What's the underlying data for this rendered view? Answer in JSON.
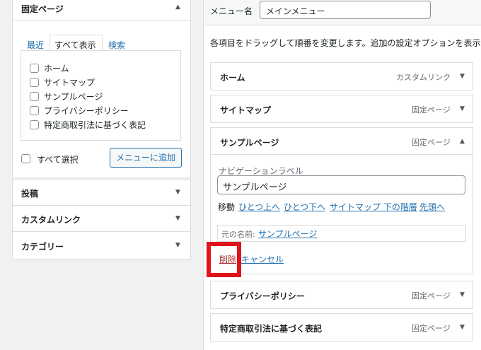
{
  "left": {
    "fixed_pages": {
      "title": "固定ページ",
      "tabs": [
        "最近",
        "すべて表示",
        "検索"
      ],
      "pages": [
        "ホーム",
        "サイトマップ",
        "サンプルページ",
        "プライバシーポリシー",
        "特定商取引法に基づく表記"
      ],
      "select_all": "すべて選択",
      "add_button": "メニューに追加"
    },
    "sections": [
      "投稿",
      "カスタムリンク",
      "カテゴリー"
    ]
  },
  "right": {
    "menu_name_label": "メニュー名",
    "menu_name_value": "メインメニュー",
    "instructions": "各項目をドラッグして順番を変更します。追加の設定オプションを表示す",
    "items": [
      {
        "title": "ホーム",
        "type": "カスタムリンク"
      },
      {
        "title": "サイトマップ",
        "type": "固定ページ"
      },
      {
        "title": "サンプルページ",
        "type": "固定ページ"
      },
      {
        "title": "プライバシーポリシー",
        "type": "固定ページ"
      },
      {
        "title": "特定商取引法に基づく表記",
        "type": "固定ページ"
      }
    ],
    "expanded": {
      "nav_label": "ナビゲーションラベル",
      "nav_value": "サンプルページ",
      "move_label": "移動",
      "move_links": [
        "ひとつ上へ",
        "ひとつ下へ",
        "サイトマップ 下の階層",
        "先頭へ"
      ],
      "original_label": "元の名前:",
      "original_link": "サンプルページ",
      "delete": "削除",
      "cancel": "キャンセル"
    }
  },
  "colors": {
    "highlight": "#e0131a",
    "link": "#2271b1",
    "delete": "#b32d2e"
  }
}
